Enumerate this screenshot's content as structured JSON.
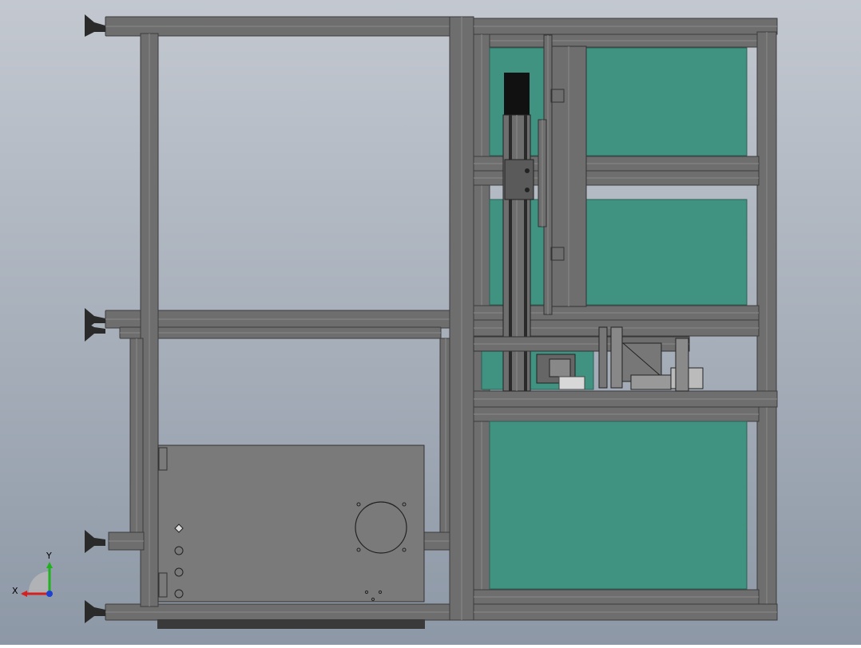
{
  "viewport": {
    "background_top": "#c3c8d0",
    "background_bottom": "#8d98a6"
  },
  "model": {
    "frame_color": "#6e6e6e",
    "frame_light": "#8a8a8a",
    "frame_dark": "#3c3c3c",
    "panel_color": "#3f9380",
    "cabinet_color": "#7a7a7a",
    "motor_color": "#111111"
  },
  "triad": {
    "x_label": "X",
    "y_label": "Y",
    "x_color": "#d42020",
    "y_color": "#20b020",
    "z_color": "#2040d0"
  }
}
